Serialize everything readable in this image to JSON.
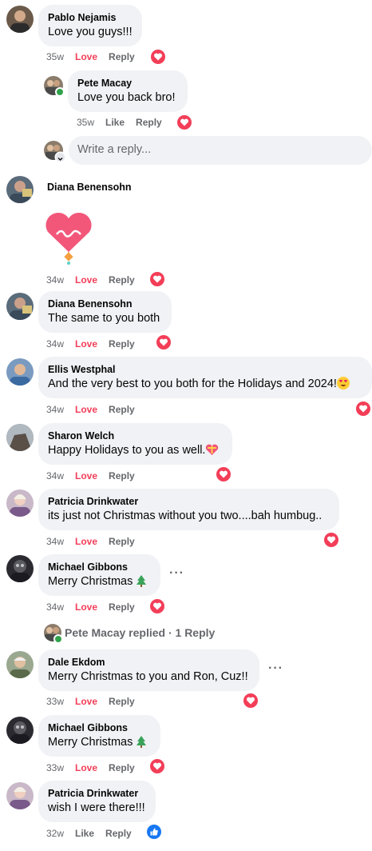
{
  "colors": {
    "love": "#f33e58",
    "like_blue": "#1877f2",
    "bubble": "#f0f2f5",
    "meta": "#65676b"
  },
  "comments": [
    {
      "name": "Pablo Nejamis",
      "text": "Love you guys!!!",
      "time": "35w",
      "reaction_label": "Love",
      "reply": "Reply",
      "reaction_icon": "love-icon"
    },
    {
      "name": "Pete Macay",
      "text": "Love you back bro!",
      "time": "35w",
      "reaction_label": "Like",
      "reply": "Reply",
      "reaction_icon": "love-icon"
    },
    {
      "name": "Diana Benensohn",
      "text": "",
      "sticker": "heart-sticker",
      "time": "34w",
      "reaction_label": "Love",
      "reply": "Reply",
      "reaction_icon": "love-icon"
    },
    {
      "name": "Diana Benensohn",
      "text": "The same to you both",
      "time": "34w",
      "reaction_label": "Love",
      "reply": "Reply",
      "reaction_icon": "love-icon"
    },
    {
      "name": "Ellis Westphal",
      "text": "And the very best to you both for the Holidays and 2024!",
      "emoji": "heart-eyes-emoji",
      "time": "34w",
      "reaction_label": "Love",
      "reply": "Reply",
      "reaction_icon": "love-icon"
    },
    {
      "name": "Sharon Welch",
      "text": "Happy Holidays to you as well.",
      "emoji": "heart-emoji",
      "time": "34w",
      "reaction_label": "Love",
      "reply": "Reply",
      "reaction_icon": "love-icon"
    },
    {
      "name": "Patricia Drinkwater",
      "text": "its just not Christmas without you two....bah humbug..",
      "time": "34w",
      "reaction_label": "Love",
      "reply": "Reply",
      "reaction_icon": "love-icon"
    },
    {
      "name": "Michael Gibbons",
      "text": "Merry Christmas",
      "emoji": "christmas-tree-emoji",
      "time": "34w",
      "reaction_label": "Love",
      "reply": "Reply",
      "reaction_icon": "love-icon"
    },
    {
      "name": "Dale Ekdom",
      "text": "Merry Christmas to you and Ron, Cuz!!",
      "time": "33w",
      "reaction_label": "Love",
      "reply": "Reply",
      "reaction_icon": "love-icon"
    },
    {
      "name": "Michael Gibbons",
      "text": "Merry Christmas",
      "emoji": "christmas-tree-emoji",
      "time": "33w",
      "reaction_label": "Love",
      "reply": "Reply",
      "reaction_icon": "love-icon"
    },
    {
      "name": "Patricia Drinkwater",
      "text": "wish I were there!!!",
      "time": "32w",
      "reaction_label": "Like",
      "reply": "Reply",
      "reaction_icon": "like-icon"
    }
  ],
  "write_reply": {
    "placeholder": "Write a reply..."
  },
  "replied_summary": {
    "author": "Pete Macay",
    "text": "replied · 1 Reply"
  },
  "more_options": "···"
}
